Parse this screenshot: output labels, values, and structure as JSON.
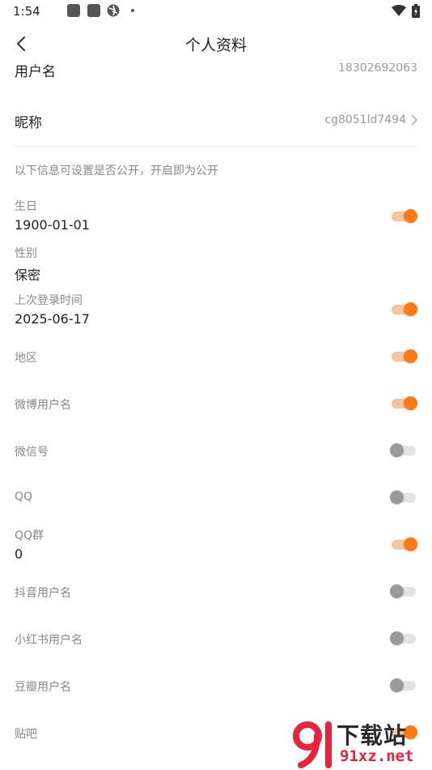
{
  "status_bar": {
    "time": "1:54"
  },
  "header": {
    "title": "个人资料"
  },
  "username_row": {
    "label": "用户名",
    "value": "18302692063"
  },
  "nickname_row": {
    "label": "昵称",
    "value": "cg8051ld7494"
  },
  "hint": "以下信息可设置是否公开，开启即为公开",
  "fields": {
    "birthday": {
      "label": "生日",
      "value": "1900-01-01",
      "public": true
    },
    "gender": {
      "label": "性别",
      "value": "保密"
    },
    "last_login": {
      "label": "上次登录时间",
      "value": "2025-06-17",
      "public": true
    },
    "region": {
      "label": "地区",
      "public": true
    },
    "weibo": {
      "label": "微博用户名",
      "public": true
    },
    "wechat": {
      "label": "微信号",
      "public": false
    },
    "qq": {
      "label": "QQ",
      "public": false
    },
    "qq_group": {
      "label": "QQ群",
      "value": "0",
      "public": true
    },
    "douyin": {
      "label": "抖音用户名",
      "public": false
    },
    "xiaohongshu": {
      "label": "小红书用户名",
      "public": false
    },
    "douban": {
      "label": "豆瓣用户名",
      "public": false
    },
    "tieba": {
      "label": "贴吧",
      "public": true
    }
  },
  "watermark": {
    "top_text": "下载站",
    "bottom_text": "91xz.net"
  },
  "colors": {
    "accent": "#ff7a14",
    "watermark_red": "#e8233c"
  }
}
